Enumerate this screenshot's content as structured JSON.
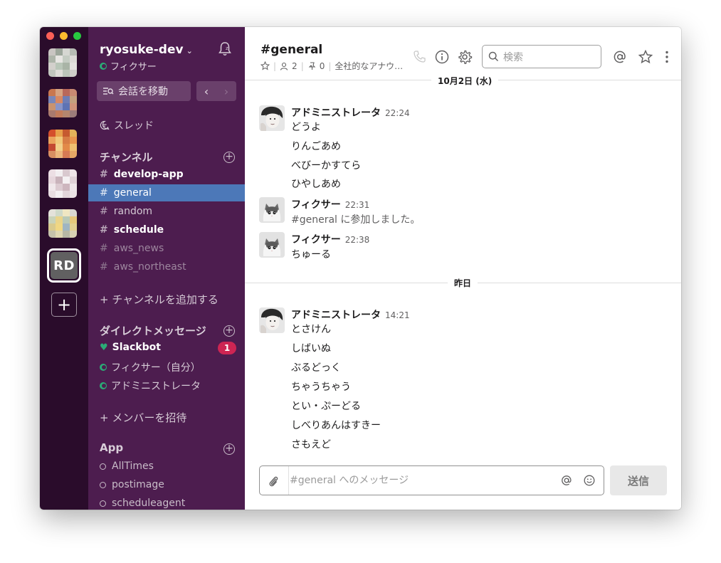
{
  "workspace": {
    "name": "ryosuke-dev",
    "user_status": "フィクサー",
    "rd_initials": "RD"
  },
  "sidebar": {
    "jump_label": "会話を移動",
    "threads_label": "スレッド",
    "channels_title": "チャンネル",
    "channels": [
      {
        "name": "develop-app",
        "state": "unread"
      },
      {
        "name": "general",
        "state": "active"
      },
      {
        "name": "random",
        "state": "normal"
      },
      {
        "name": "schedule",
        "state": "unread"
      },
      {
        "name": "aws_news",
        "state": "muted"
      },
      {
        "name": "aws_northeast",
        "state": "muted"
      }
    ],
    "add_channel": "+ チャンネルを追加する",
    "dm_title": "ダイレクトメッセージ",
    "dms": [
      {
        "name": "Slackbot",
        "badge": "1"
      },
      {
        "name": "フィクサー（自分）"
      },
      {
        "name": "アドミニストレータ"
      }
    ],
    "invite": "+ メンバーを招待",
    "app_title": "App",
    "apps": [
      "AllTimes",
      "postimage",
      "scheduleagent"
    ]
  },
  "header": {
    "title": "#general",
    "members": "2",
    "pins": "0",
    "topic": "全社的なアナウ…",
    "search_placeholder": "検索"
  },
  "messages": {
    "day1": "10月2日 (水)",
    "day2": "昨日",
    "g1": {
      "name": "アドミニストレータ",
      "time": "22:24",
      "lines": [
        "どうよ",
        "りんごあめ",
        "べびーかすてら",
        "ひやしあめ"
      ]
    },
    "g2": {
      "name": "フィクサー",
      "time": "22:31",
      "lines": [
        "#general に参加しました。"
      ]
    },
    "g3": {
      "name": "フィクサー",
      "time": "22:38",
      "lines": [
        "ちゅーる"
      ]
    },
    "g4": {
      "name": "アドミニストレータ",
      "time": "14:21",
      "lines": [
        "とさけん",
        "しばいぬ",
        "ぶるどっく",
        "ちゃうちゃう",
        "とい・ぷーどる",
        "しべりあんはすきー",
        "さもえど"
      ]
    }
  },
  "composer": {
    "placeholder": "#general へのメッセージ",
    "send_label": "送信"
  },
  "colors": {
    "rail": "#2a0c2b",
    "sidebar": "#4d1d4f",
    "active_channel": "#4c78b8",
    "presence": "#2bac76",
    "badge": "#cd2553"
  }
}
